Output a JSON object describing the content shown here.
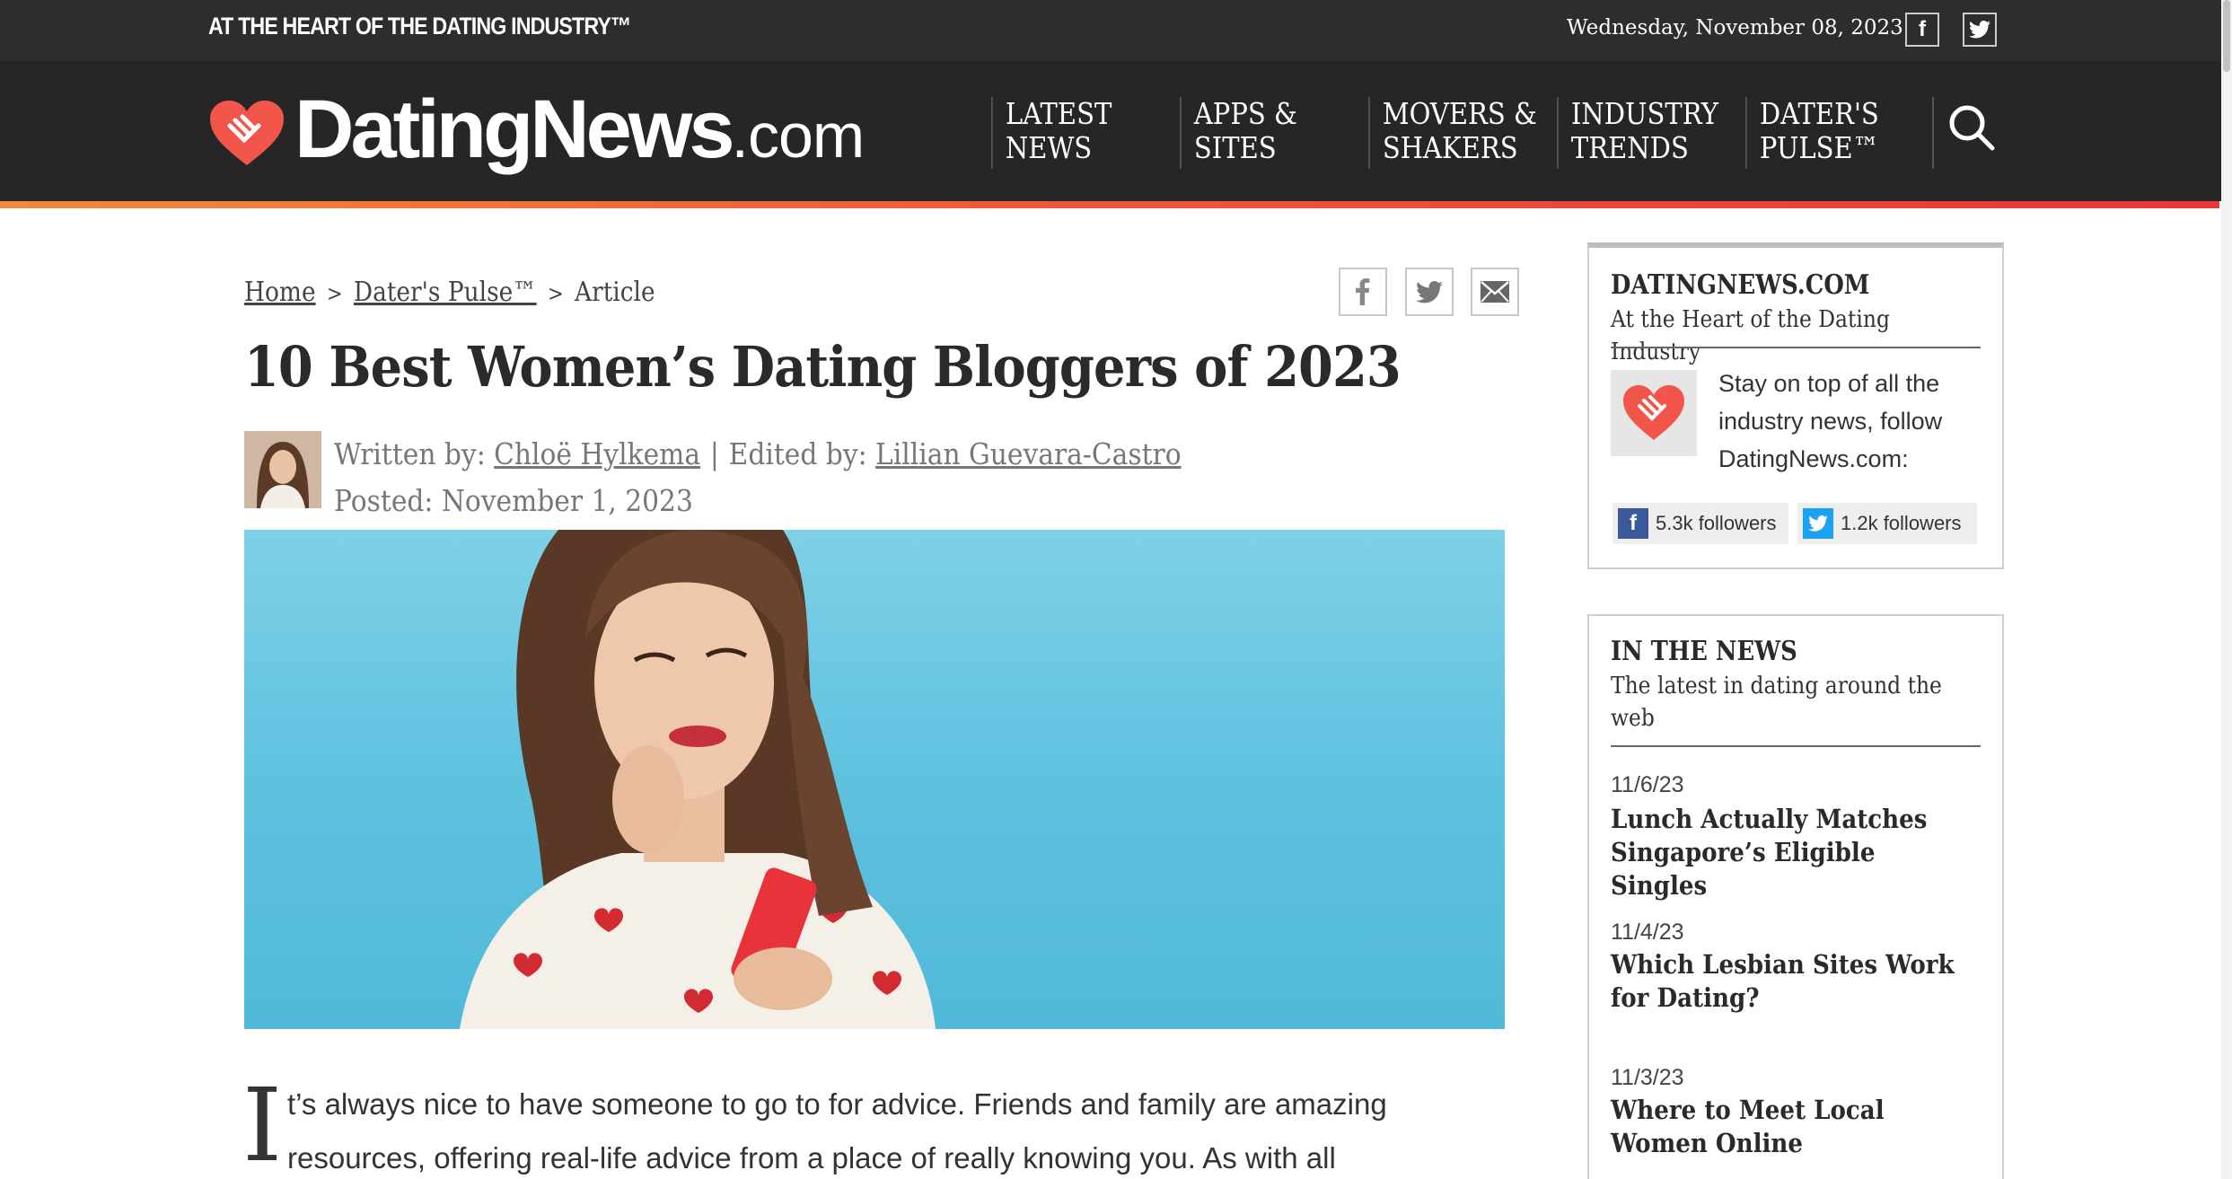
{
  "topbar": {
    "tagline": "AT THE HEART OF THE DATING INDUSTRY™",
    "date": "Wednesday, November 08, 2023",
    "facebook_glyph": "f",
    "twitter_icon": "twitter-icon"
  },
  "header": {
    "logo_main": "DatingNews",
    "logo_tld": ".com",
    "nav": [
      {
        "line1": "LATEST",
        "line2": "NEWS"
      },
      {
        "line1": "APPS &",
        "line2": "SITES"
      },
      {
        "line1": "MOVERS &",
        "line2": "SHAKERS"
      },
      {
        "line1": "INDUSTRY",
        "line2": "TRENDS"
      },
      {
        "line1": "DATER'S",
        "line2": "PULSE™"
      }
    ],
    "search_icon": "search-icon"
  },
  "colors": {
    "accent_orange": "#f08a3a",
    "accent_red": "#e8363a",
    "heart": "#f2554a",
    "header_bg": "#262626"
  },
  "article": {
    "breadcrumb": {
      "home": "Home",
      "section": "Dater's Pulse™",
      "current": "Article",
      "separator": ">"
    },
    "title": "10 Best Women’s Dating Bloggers of 2023",
    "byline": {
      "written_label": "Written by:",
      "author": "Chloë Hylkema",
      "divider": "|",
      "edited_label": "Edited by:",
      "editor": "Lillian Guevara-Castro",
      "posted": "Posted: November 1, 2023"
    },
    "dropcap": "I",
    "body_first": "t’s always nice to have someone to go to for advice. Friends and family are amazing resources, offering real-life advice from a place of really knowing you. As with all"
  },
  "sidebar": {
    "about": {
      "title": "DATINGNEWS.COM",
      "subtitle": "At the Heart of the Dating Industry",
      "stay_text": "Stay on top of all the industry news, follow DatingNews.com:",
      "facebook_followers": "5.3k followers",
      "twitter_followers": "1.2k followers",
      "facebook_glyph": "f"
    },
    "in_the_news": {
      "title": "IN THE NEWS",
      "subtitle": "The latest in dating around the web",
      "items": [
        {
          "date": "11/6/23",
          "title": "Lunch Actually Matches Singapore’s Eligible Singles"
        },
        {
          "date": "11/4/23",
          "title": "Which Lesbian Sites Work for Dating?"
        },
        {
          "date": "11/3/23",
          "title": "Where to Meet Local Women Online"
        }
      ]
    }
  }
}
